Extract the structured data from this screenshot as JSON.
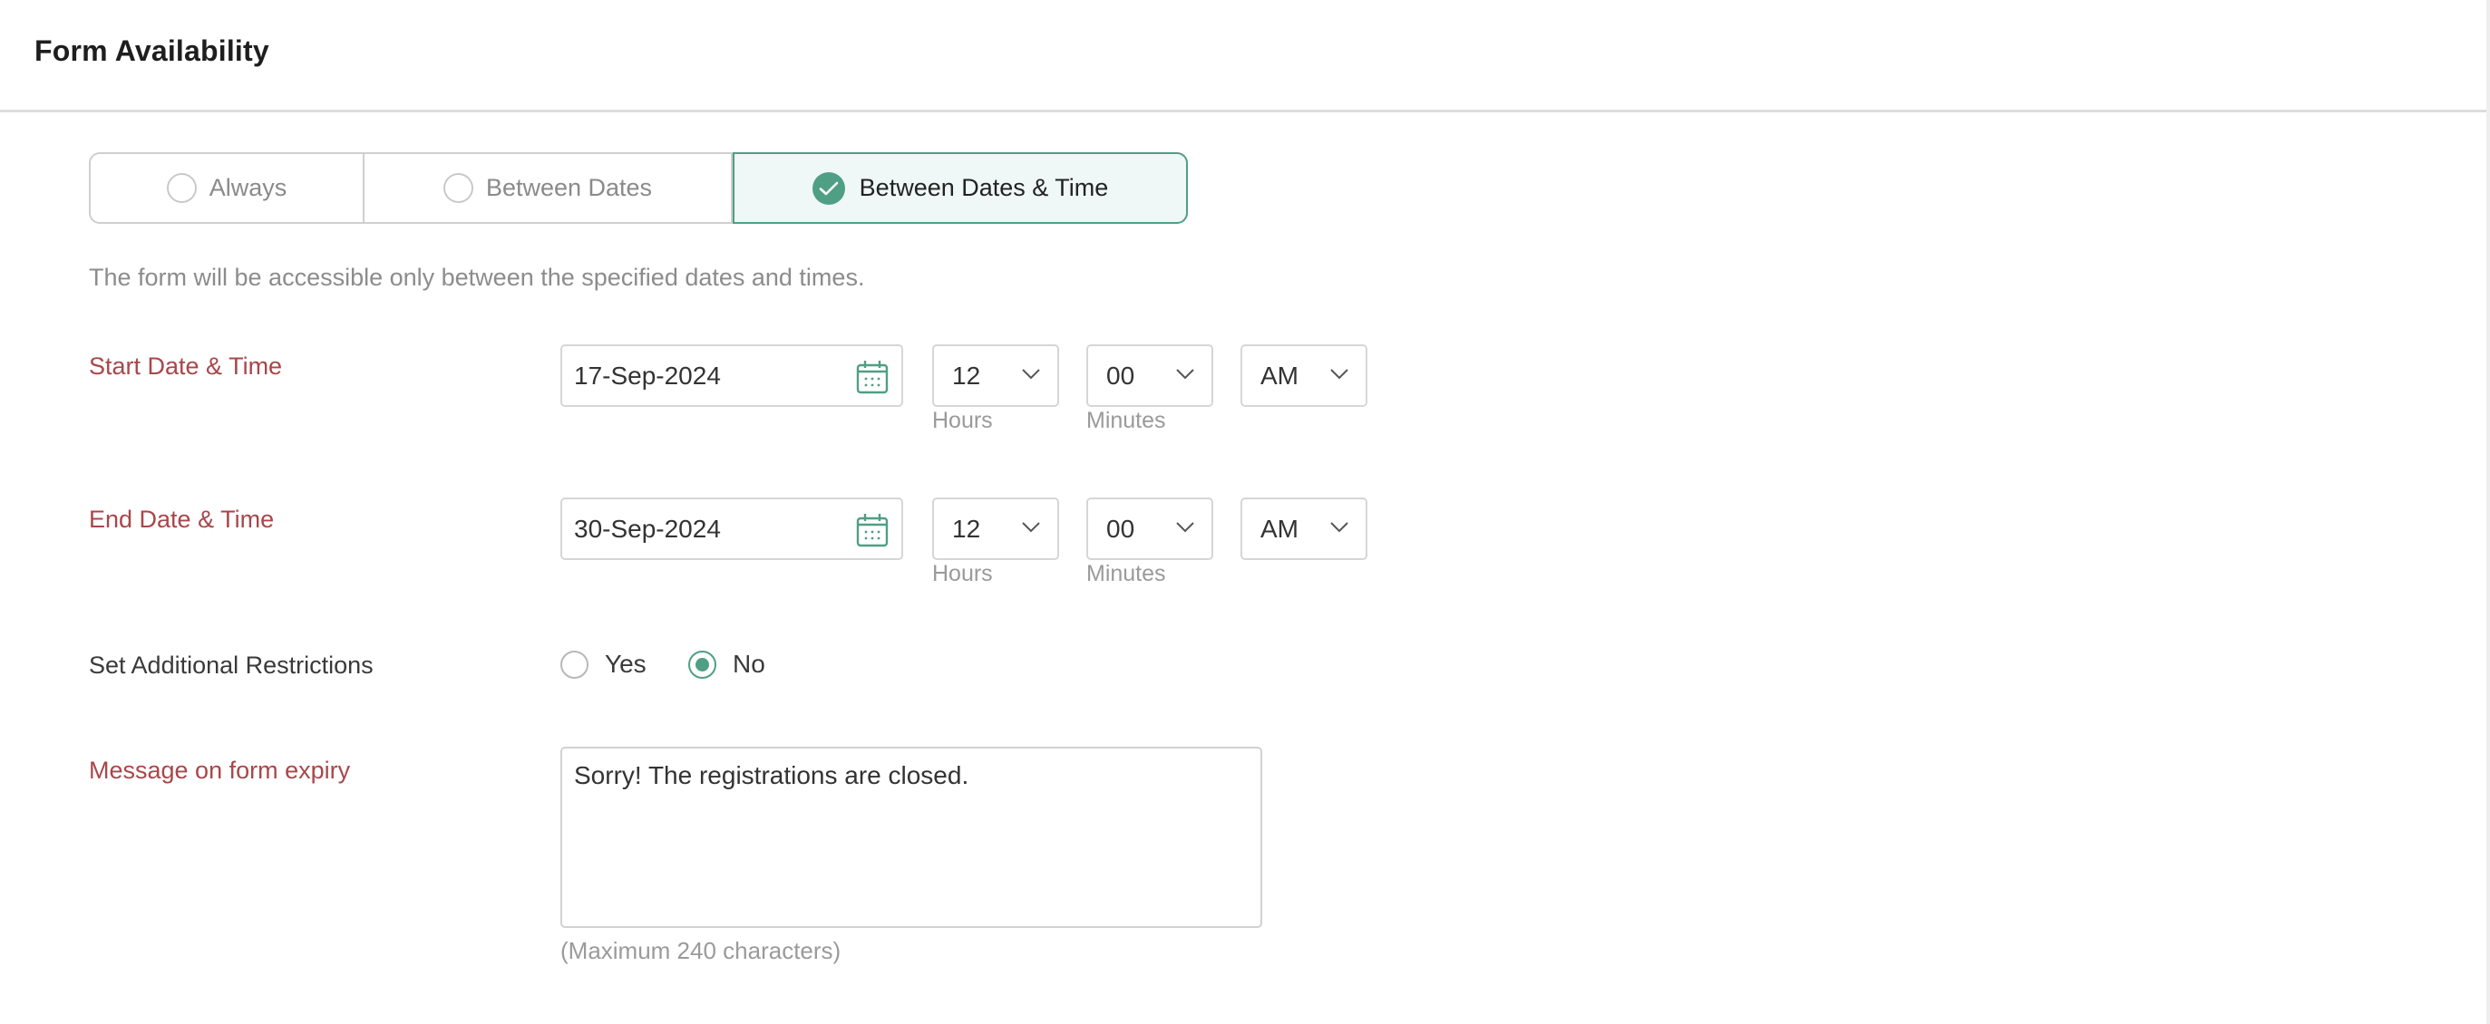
{
  "header": {
    "title": "Form Availability"
  },
  "availability": {
    "options": [
      {
        "label": "Always",
        "selected": false
      },
      {
        "label": "Between Dates",
        "selected": false
      },
      {
        "label": "Between Dates & Time",
        "selected": true
      }
    ],
    "hint": "The form will be accessible only between the specified dates and times."
  },
  "start": {
    "label": "Start Date & Time",
    "date": "17-Sep-2024",
    "hours": "12",
    "minutes": "00",
    "period": "AM",
    "hours_label": "Hours",
    "minutes_label": "Minutes"
  },
  "end": {
    "label": "End Date & Time",
    "date": "30-Sep-2024",
    "hours": "12",
    "minutes": "00",
    "period": "AM",
    "hours_label": "Hours",
    "minutes_label": "Minutes"
  },
  "restrictions": {
    "label": "Set Additional Restrictions",
    "options": [
      {
        "label": "Yes",
        "selected": false
      },
      {
        "label": "No",
        "selected": true
      }
    ]
  },
  "expiry": {
    "label": "Message on form expiry",
    "value": "Sorry! The registrations are closed.",
    "limit_note": "(Maximum 240 characters)"
  },
  "colors": {
    "accent": "#4f9f85",
    "accent_bg": "#eff8f6",
    "required_label": "#a8474a",
    "border": "#d6d6d6"
  }
}
